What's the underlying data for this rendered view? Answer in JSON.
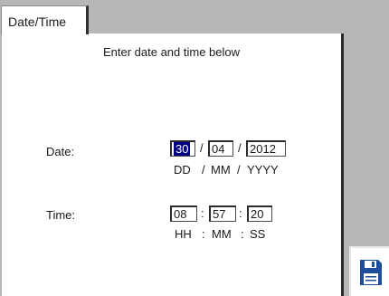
{
  "tab": {
    "label": "Date/Time"
  },
  "panel": {
    "title": "Enter date and time below"
  },
  "date": {
    "label": "Date:",
    "day": "30",
    "month": "04",
    "year": "2012",
    "sep1": "/",
    "sep2": "/",
    "format_day": "DD",
    "format_sep1": "/",
    "format_month": "MM",
    "format_sep2": "/",
    "format_year": "YYYY"
  },
  "time": {
    "label": "Time:",
    "hours": "08",
    "minutes": "57",
    "seconds": "20",
    "sep1": ":",
    "sep2": ":",
    "format_hours": "HH",
    "format_sep1": ":",
    "format_minutes": "MM",
    "format_sep2": ":",
    "format_seconds": "SS"
  },
  "icons": {
    "save": "floppy-disk-icon"
  },
  "colors": {
    "selection": "#000080",
    "icon": "#1d4e9c",
    "background": "#b7b7b7"
  }
}
